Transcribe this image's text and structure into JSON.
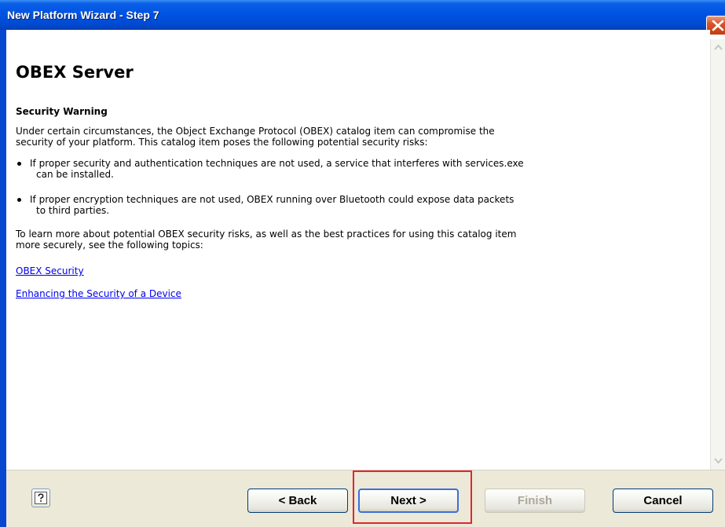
{
  "window": {
    "title": "New Platform Wizard - Step 7",
    "title_color": "#ffffff",
    "titlebar_color": "#0054e3",
    "close_icon": "close-icon"
  },
  "content": {
    "heading": "OBEX Server",
    "subheading": "Security Warning",
    "intro_lines": [
      "Under certain circumstances, the Object Exchange Protocol (OBEX) catalog item can compromise the",
      "security of your platform. This catalog item poses the following potential security risks:"
    ],
    "bullets": [
      {
        "line1": "If proper security and authentication techniques are not used, a service that interferes with services.exe",
        "line2": "can be installed."
      },
      {
        "line1": "If proper encryption techniques are not used, OBEX running over Bluetooth could expose data packets",
        "line2": "to third parties."
      }
    ],
    "learn_more_lines": [
      "To learn more about potential OBEX security risks, as well as the best practices for using this catalog item",
      "more securely, see the following topics:"
    ],
    "links": [
      "OBEX Security",
      "Enhancing the Security of a Device"
    ],
    "link_color": "#0000ee"
  },
  "buttons": {
    "help_icon": "help-icon",
    "back": "< Back",
    "next": "Next >",
    "finish": "Finish",
    "cancel": "Cancel",
    "finish_disabled": true,
    "highlight_color": "#e0262e"
  }
}
